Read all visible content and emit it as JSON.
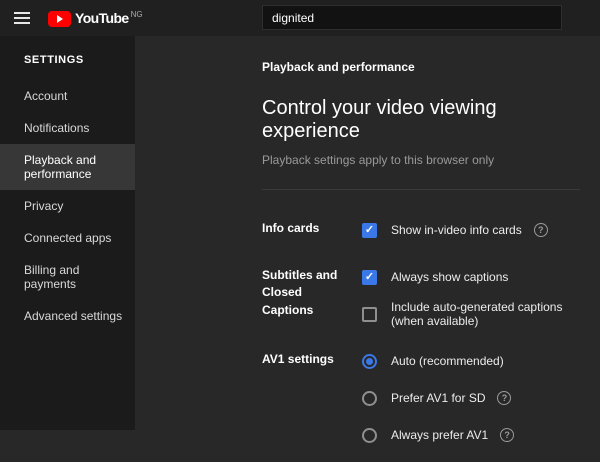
{
  "colors": {
    "accent": "#3b78e7",
    "brand_red": "#ff0000"
  },
  "icons": {
    "check": "✓",
    "help": "?"
  },
  "topbar": {
    "logo_text": "YouTube",
    "logo_country": "NG",
    "search_value": "dignited"
  },
  "sidebar": {
    "title": "SETTINGS",
    "items": [
      {
        "label": "Account",
        "selected": false
      },
      {
        "label": "Notifications",
        "selected": false
      },
      {
        "label": "Playback and performance",
        "selected": true
      },
      {
        "label": "Privacy",
        "selected": false
      },
      {
        "label": "Connected apps",
        "selected": false
      },
      {
        "label": "Billing and payments",
        "selected": false
      },
      {
        "label": "Advanced settings",
        "selected": false
      }
    ]
  },
  "main": {
    "category": "Playback and performance",
    "title": "Control your video viewing experience",
    "subtitle": "Playback settings apply to this browser only",
    "sections": [
      {
        "label": "Info cards",
        "controls": [
          {
            "type": "checkbox",
            "checked": true,
            "label": "Show in-video info cards",
            "help": true
          }
        ]
      },
      {
        "label": "Subtitles and Closed Captions",
        "controls": [
          {
            "type": "checkbox",
            "checked": true,
            "label": "Always show captions",
            "help": false
          },
          {
            "type": "checkbox",
            "checked": false,
            "label": "Include auto-generated captions (when available)",
            "help": false
          }
        ]
      },
      {
        "label": "AV1 settings",
        "controls": [
          {
            "type": "radio",
            "checked": true,
            "label": "Auto (recommended)",
            "help": false
          },
          {
            "type": "radio",
            "checked": false,
            "label": "Prefer AV1 for SD",
            "help": true
          },
          {
            "type": "radio",
            "checked": false,
            "label": "Always prefer AV1",
            "help": true
          }
        ]
      }
    ]
  }
}
